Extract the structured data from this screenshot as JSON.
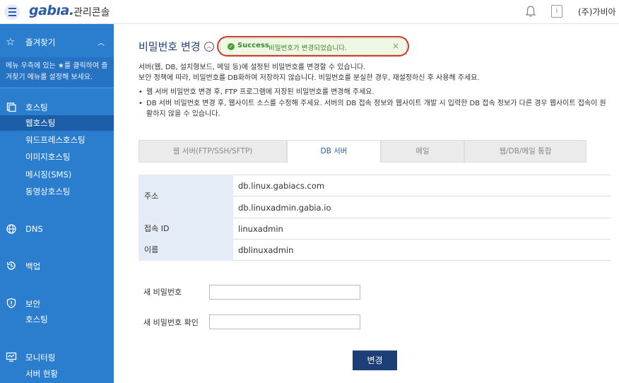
{
  "header": {
    "logo": "gabıa.",
    "console_label": "관리콘솔",
    "user": "(주)가비아"
  },
  "sidebar": {
    "favorites_label": "즐겨찾기",
    "favorites_desc": "메뉴 우측에 있는 ★를 클릭하여 즐겨찾기 메뉴를 설정해 보세요.",
    "hosting_label": "호스팅",
    "hosting_items": [
      "웹호스팅",
      "워드프레스호스팅",
      "이미지호스팅",
      "메시징(SMS)",
      "동영상호스팅"
    ],
    "dns_label": "DNS",
    "backup_label": "백업",
    "security_label": "보안",
    "security_items": [
      "호스팅"
    ],
    "monitoring_label": "모니터링",
    "monitoring_items": [
      "서버 현황"
    ]
  },
  "main": {
    "title": "비밀번호 변경",
    "alert": {
      "strong": "Success",
      "message": "비밀번호가 변경되었습니다."
    },
    "desc_line1": "서버(웹, DB, 설치형보드, 메일 등)에 설정된 비밀번호를 변경할 수 있습니다.",
    "desc_line2": "보안 정책에 따라, 비밀번호를 DB화하여 저장하지 않습니다. 비밀번호를 분실한 경우, 재설정하신 후 사용해 주세요.",
    "bullet1": "웹 서버 비밀번호 변경 후, FTP 프로그램에 저장된 비밀번호를 변경해 주세요.",
    "bullet2_line1": "DB 서버 비밀번호 변경 후, 웹사이트 소스를 수정해 주세요. 서버의 DB 접속 정보와 웹사이트 개발 시 입력한 DB 접속 정보가 다른 경우 웹사이트 접속이 원",
    "bullet2_line2": "활하지 않을 수 있습니다.",
    "tabs": [
      "웹 서버(FTP/SSH/SFTP)",
      "DB 서버",
      "메일",
      "웹/DB/메일 통합"
    ],
    "table": {
      "address_label": "주소",
      "address_1": "db.linux.gabiacs.com",
      "address_2": "db.linuxadmin.gabia.io",
      "id_label": "접속 ID",
      "id_value": "linuxadmin",
      "name_label": "이름",
      "name_value": "dblinuxadmin"
    },
    "form": {
      "new_pw_label": "새 비밀번호",
      "new_pw_value": "",
      "confirm_pw_label": "새 비밀번호 확인",
      "confirm_pw_value": "",
      "submit_label": "변경"
    }
  }
}
